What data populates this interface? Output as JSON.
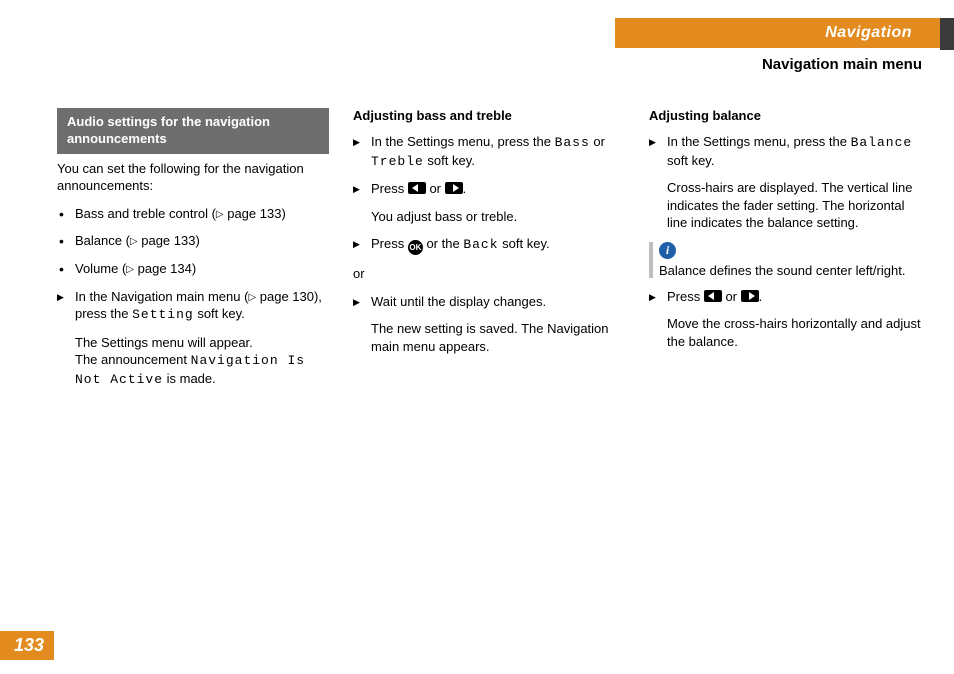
{
  "header": {
    "chapter": "Navigation",
    "section": "Navigation main menu"
  },
  "col1": {
    "box_heading": "Audio settings for the navigation announcements",
    "intro": "You can set the following for the navigation announcements:",
    "bullets": {
      "b1_pre": "Bass and treble control (",
      "b1_post": " page 133)",
      "b2_pre": "Balance (",
      "b2_post": " page 133)",
      "b3_pre": "Volume (",
      "b3_post": " page 134)"
    },
    "step_pre": "In the Navigation main menu (",
    "step_mid": " page 130), press the ",
    "step_key": "Setting",
    "step_post": " soft key.",
    "result1": "The Settings menu will appear.",
    "result2_pre": "The announcement ",
    "result2_code": "Navigation Is Not Active",
    "result2_post": " is made."
  },
  "col2": {
    "heading": "Adjusting bass and treble",
    "s1_pre": "In the Settings menu, press the ",
    "s1_k1": "Bass",
    "s1_mid": " or ",
    "s1_k2": "Treble",
    "s1_post": " soft key.",
    "s2_pre": "Press ",
    "s2_or": " or ",
    "s2_post": ".",
    "s2_result": "You adjust bass or treble.",
    "s3_pre": "Press ",
    "s3_ok": "OK",
    "s3_mid": " or the ",
    "s3_back": "Back",
    "s3_post": " soft key.",
    "or": "or",
    "s4": "Wait until the display changes.",
    "s4_result": "The new setting is saved. The Navigation main menu appears."
  },
  "col3": {
    "heading": "Adjusting balance",
    "s1_pre": "In the Settings menu, press the ",
    "s1_key": "Balance",
    "s1_post": " soft key.",
    "s1_result": "Cross-hairs are displayed. The vertical line indicates the fader setting. The horizontal line indicates the balance setting.",
    "info_i": "i",
    "info_text": "Balance defines the sound center left/right.",
    "s2_pre": "Press ",
    "s2_or": " or ",
    "s2_post": ".",
    "s2_result": "Move the cross-hairs horizontally and adjust the balance."
  },
  "page_number": "133"
}
